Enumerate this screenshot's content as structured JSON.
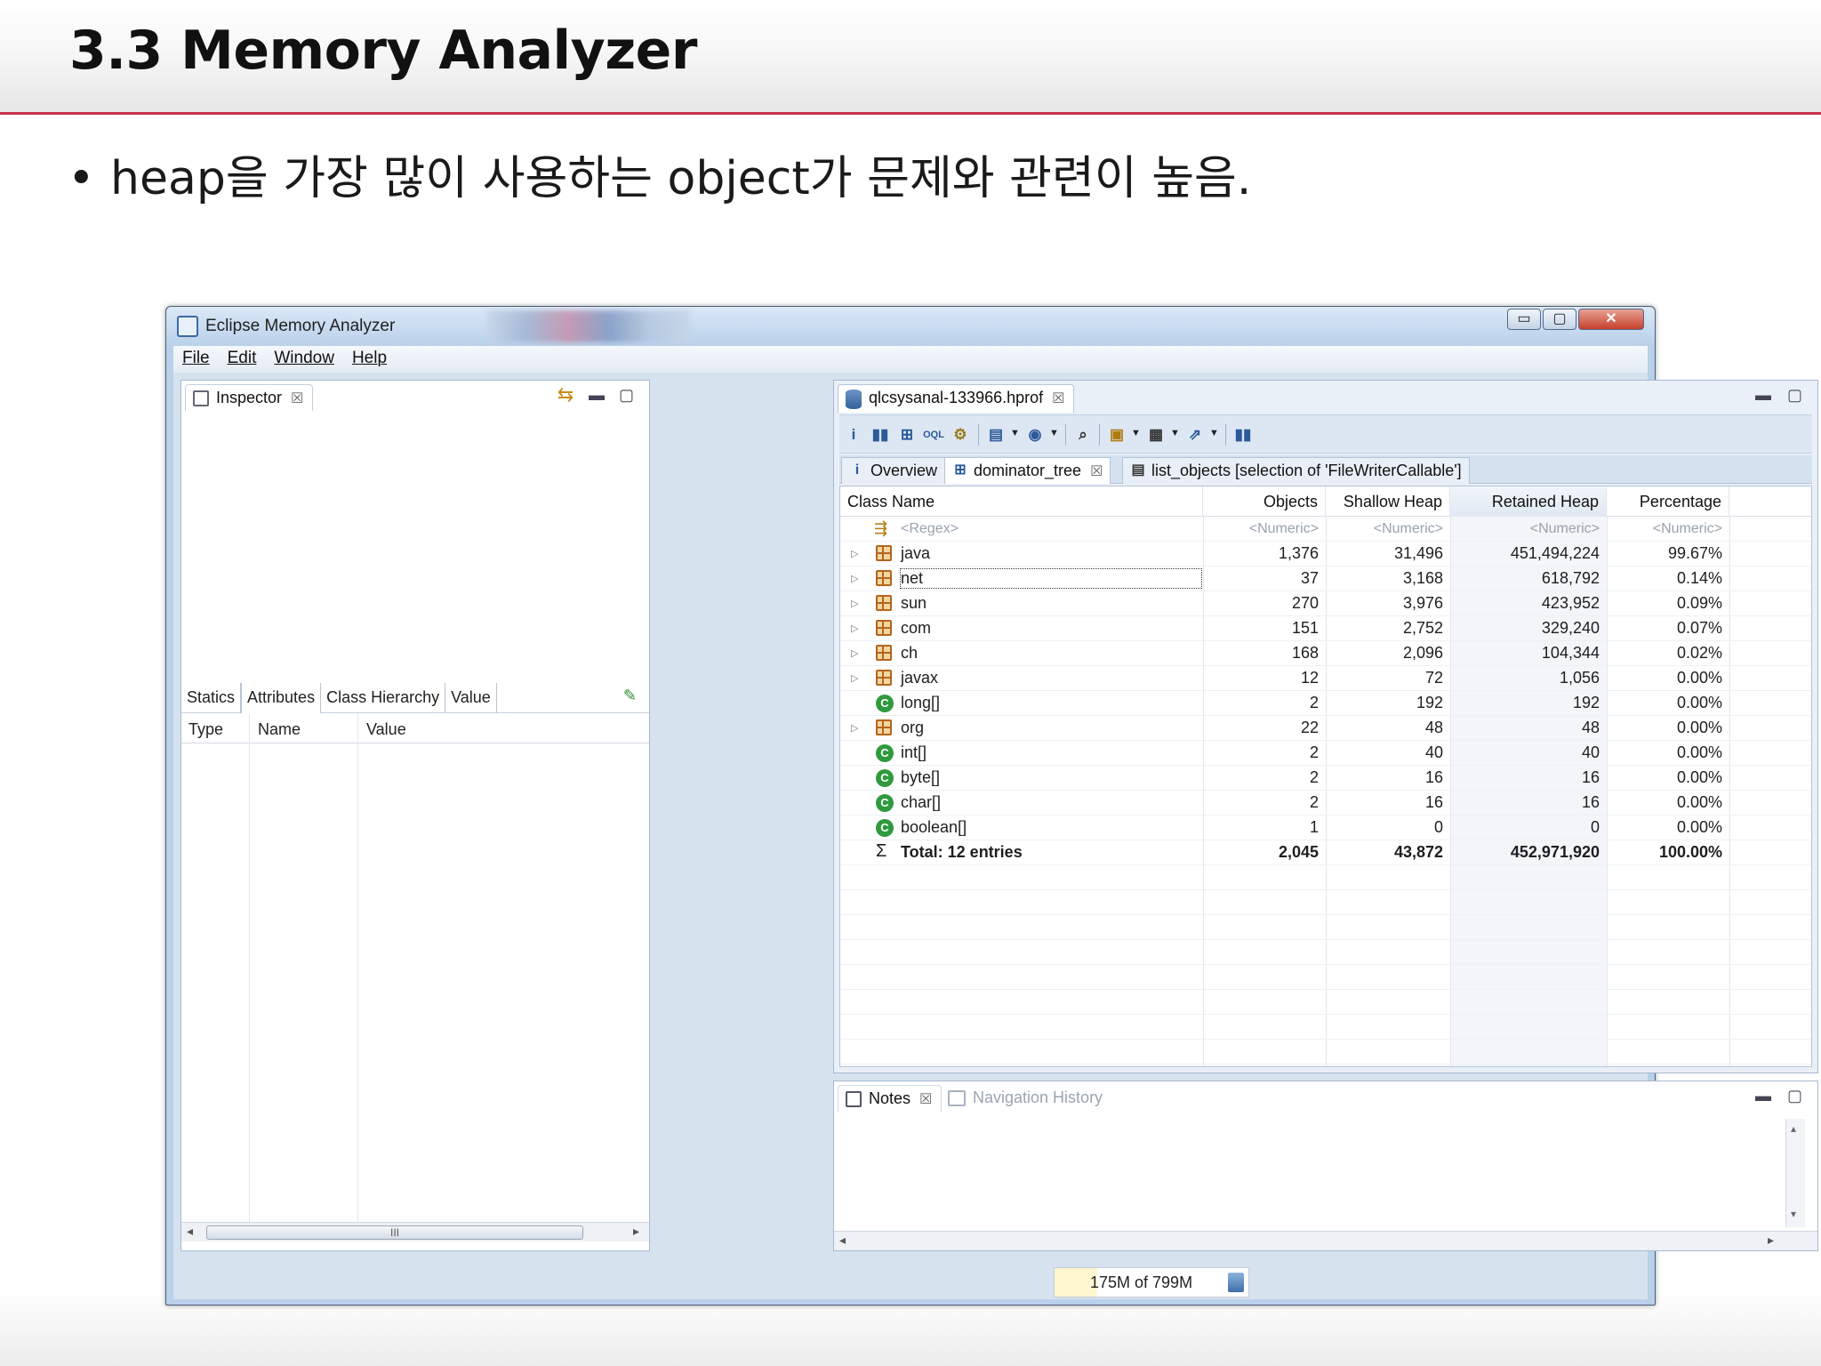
{
  "slide": {
    "title": "3.3 Memory Analyzer",
    "bullet": "heap을 가장 많이 사용하는 object가 문제와 관련이 높음.",
    "colors": {
      "accent_rule": "#c8314a"
    }
  },
  "window": {
    "title": "Eclipse Memory Analyzer",
    "controls": {
      "minimize": "▭",
      "maximize": "▢",
      "close": "✕"
    },
    "menu": [
      "File",
      "Edit",
      "Window",
      "Help"
    ]
  },
  "inspector": {
    "tab_label": "Inspector",
    "close_glyph": "☒",
    "tabs": [
      "Statics",
      "Attributes",
      "Class Hierarchy",
      "Value"
    ],
    "active_tab": "Attributes",
    "columns": [
      "Type",
      "Name",
      "Value"
    ],
    "scroll_thumb": "III"
  },
  "editor": {
    "file_tab": "qlcsysanal-133966.hprof",
    "close_glyph": "☒",
    "toolbar_icons": [
      "info-icon",
      "histogram-icon",
      "dominator-tree-icon",
      "oql-icon",
      "gear-icon",
      "query-browser-icon",
      "heap-dump-icon",
      "search-icon",
      "group-by-icon",
      "calculate-icon",
      "export-icon",
      "retained-icon"
    ],
    "subtabs": [
      {
        "label": "Overview",
        "icon": "i"
      },
      {
        "label": "dominator_tree",
        "icon": "⊞"
      },
      {
        "label": "list_objects [selection of 'FileWriterCallable']",
        "icon": "▤"
      }
    ],
    "columns": [
      "Class Name",
      "Objects",
      "Shallow Heap",
      "Retained Heap",
      "Percentage"
    ],
    "sorted_column": "Retained Heap",
    "filter_row": {
      "name": "<Regex>",
      "objects": "<Numeric>",
      "shallow": "<Numeric>",
      "retained": "<Numeric>",
      "percentage": "<Numeric>"
    },
    "rows": [
      {
        "name": "java",
        "kind": "package",
        "expandable": true,
        "objects": "1,376",
        "shallow": "31,496",
        "retained": "451,494,224",
        "percentage": "99.67%"
      },
      {
        "name": "net",
        "kind": "package",
        "expandable": true,
        "objects": "37",
        "shallow": "3,168",
        "retained": "618,792",
        "percentage": "0.14%",
        "selected": true
      },
      {
        "name": "sun",
        "kind": "package",
        "expandable": true,
        "objects": "270",
        "shallow": "3,976",
        "retained": "423,952",
        "percentage": "0.09%"
      },
      {
        "name": "com",
        "kind": "package",
        "expandable": true,
        "objects": "151",
        "shallow": "2,752",
        "retained": "329,240",
        "percentage": "0.07%"
      },
      {
        "name": "ch",
        "kind": "package",
        "expandable": true,
        "objects": "168",
        "shallow": "2,096",
        "retained": "104,344",
        "percentage": "0.02%"
      },
      {
        "name": "javax",
        "kind": "package",
        "expandable": true,
        "objects": "12",
        "shallow": "72",
        "retained": "1,056",
        "percentage": "0.00%"
      },
      {
        "name": "long[]",
        "kind": "class",
        "expandable": false,
        "objects": "2",
        "shallow": "192",
        "retained": "192",
        "percentage": "0.00%"
      },
      {
        "name": "org",
        "kind": "package",
        "expandable": true,
        "objects": "22",
        "shallow": "48",
        "retained": "48",
        "percentage": "0.00%"
      },
      {
        "name": "int[]",
        "kind": "class",
        "expandable": false,
        "objects": "2",
        "shallow": "40",
        "retained": "40",
        "percentage": "0.00%"
      },
      {
        "name": "byte[]",
        "kind": "class",
        "expandable": false,
        "objects": "2",
        "shallow": "16",
        "retained": "16",
        "percentage": "0.00%"
      },
      {
        "name": "char[]",
        "kind": "class",
        "expandable": false,
        "objects": "2",
        "shallow": "16",
        "retained": "16",
        "percentage": "0.00%"
      },
      {
        "name": "boolean[]",
        "kind": "class",
        "expandable": false,
        "objects": "1",
        "shallow": "0",
        "retained": "0",
        "percentage": "0.00%"
      }
    ],
    "total": {
      "symbol": "Σ",
      "name": "Total: 12 entries",
      "objects": "2,045",
      "shallow": "43,872",
      "retained": "452,971,920",
      "percentage": "100.00%"
    }
  },
  "notes": {
    "tab_label": "Notes",
    "close_glyph": "☒",
    "nav_label": "Navigation History"
  },
  "status": {
    "heap_text": "175M of 799M",
    "heap_used_fraction": 0.22
  }
}
